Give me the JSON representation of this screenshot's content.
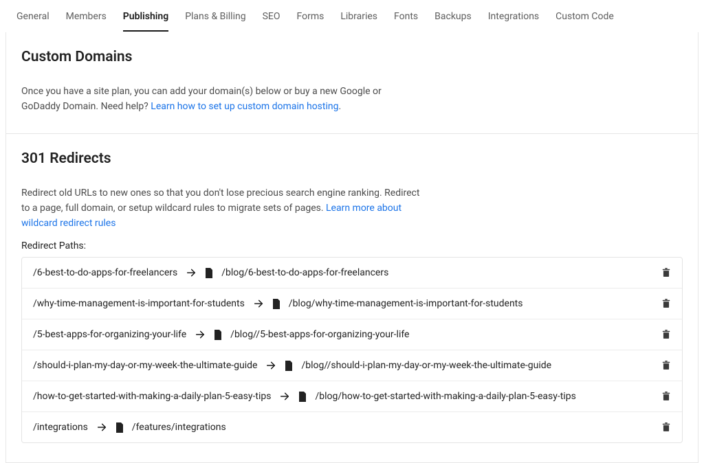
{
  "tabs": [
    {
      "label": "General",
      "active": false
    },
    {
      "label": "Members",
      "active": false
    },
    {
      "label": "Publishing",
      "active": true
    },
    {
      "label": "Plans & Billing",
      "active": false
    },
    {
      "label": "SEO",
      "active": false
    },
    {
      "label": "Forms",
      "active": false
    },
    {
      "label": "Libraries",
      "active": false
    },
    {
      "label": "Fonts",
      "active": false
    },
    {
      "label": "Backups",
      "active": false
    },
    {
      "label": "Integrations",
      "active": false
    },
    {
      "label": "Custom Code",
      "active": false
    }
  ],
  "customDomains": {
    "title": "Custom Domains",
    "desc1": "Once you have a site plan, you can add your domain(s) below or buy a new Google or GoDaddy Domain. Need help? ",
    "link": "Learn how to set up custom domain hosting",
    "desc2": "."
  },
  "redirects": {
    "title": "301 Redirects",
    "desc1": "Redirect old URLs to new ones so that you don't lose precious search engine ranking. Redirect to a page, full domain, or setup wildcard rules to migrate sets of pages. ",
    "link": "Learn more about wildcard redirect rules",
    "subhead": "Redirect Paths:",
    "rows": [
      {
        "from": "/6-best-to-do-apps-for-freelancers",
        "to": "/blog/6-best-to-do-apps-for-freelancers"
      },
      {
        "from": "/why-time-management-is-important-for-students",
        "to": "/blog/why-time-management-is-important-for-students"
      },
      {
        "from": "/5-best-apps-for-organizing-your-life",
        "to": "/blog//5-best-apps-for-organizing-your-life"
      },
      {
        "from": "/should-i-plan-my-day-or-my-week-the-ultimate-guide",
        "to": "/blog//should-i-plan-my-day-or-my-week-the-ultimate-guide"
      },
      {
        "from": "/how-to-get-started-with-making-a-daily-plan-5-easy-tips",
        "to": "/blog/how-to-get-started-with-making-a-daily-plan-5-easy-tips"
      },
      {
        "from": "/integrations",
        "to": "/features/integrations"
      }
    ]
  }
}
